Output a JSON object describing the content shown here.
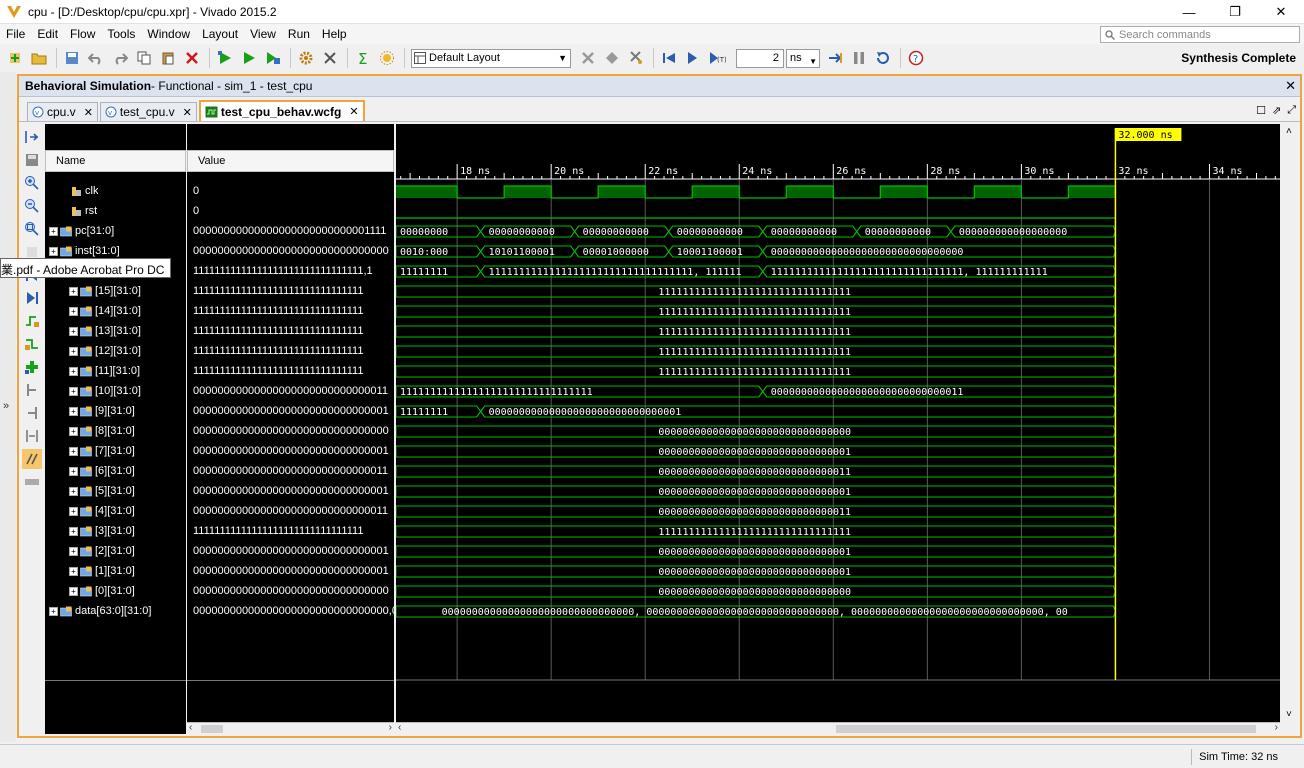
{
  "window": {
    "title": "cpu - [D:/Desktop/cpu/cpu.xpr] - Vivado 2015.2",
    "minimize": "—",
    "maximize": "❐",
    "close": "✕"
  },
  "menu": [
    "File",
    "Edit",
    "Flow",
    "Tools",
    "Window",
    "Layout",
    "View",
    "Run",
    "Help"
  ],
  "command_search": {
    "placeholder": "Search commands"
  },
  "toolbar": {
    "layout": "Default Layout",
    "run_time_value": "2",
    "run_time_unit": "ns",
    "status": "Synthesis Complete"
  },
  "panel": {
    "title_bold": "Behavioral Simulation",
    "title_rest": " - Functional - sim_1 - test_cpu",
    "close": "✕"
  },
  "tabs": [
    {
      "label": "cpu.v",
      "active": false
    },
    {
      "label": "test_cpu.v",
      "active": false
    },
    {
      "label": "test_cpu_behav.wcfg",
      "active": true
    }
  ],
  "columns": {
    "name": "Name",
    "value": "Value"
  },
  "tooltip": "業.pdf - Adobe Acrobat Pro DC",
  "signals": [
    {
      "name": "clk",
      "value": "0",
      "indent": 1,
      "type": "bit",
      "expand": false
    },
    {
      "name": "rst",
      "value": "0",
      "indent": 1,
      "type": "bit",
      "expand": false
    },
    {
      "name": "pc[31:0]",
      "value": "00000000000000000000000000001111",
      "indent": 0,
      "type": "bus",
      "expand": true
    },
    {
      "name": "inst[31:0]",
      "value": "00000000000000000000000000000000",
      "indent": 0,
      "type": "bus",
      "expand": true
    },
    {
      "name": "",
      "value": "11111111111111111111111111111111,1",
      "indent": 0,
      "type": "bus",
      "expand": true
    },
    {
      "name": "[15][31:0]",
      "value": "11111111111111111111111111111111",
      "indent": 2,
      "type": "bus",
      "expand": true
    },
    {
      "name": "[14][31:0]",
      "value": "11111111111111111111111111111111",
      "indent": 2,
      "type": "bus",
      "expand": true
    },
    {
      "name": "[13][31:0]",
      "value": "11111111111111111111111111111111",
      "indent": 2,
      "type": "bus",
      "expand": true
    },
    {
      "name": "[12][31:0]",
      "value": "11111111111111111111111111111111",
      "indent": 2,
      "type": "bus",
      "expand": true
    },
    {
      "name": "[11][31:0]",
      "value": "11111111111111111111111111111111",
      "indent": 2,
      "type": "bus",
      "expand": true
    },
    {
      "name": "[10][31:0]",
      "value": "00000000000000000000000000000011",
      "indent": 2,
      "type": "bus",
      "expand": true
    },
    {
      "name": "[9][31:0]",
      "value": "00000000000000000000000000000001",
      "indent": 2,
      "type": "bus",
      "expand": true
    },
    {
      "name": "[8][31:0]",
      "value": "00000000000000000000000000000000",
      "indent": 2,
      "type": "bus",
      "expand": true
    },
    {
      "name": "[7][31:0]",
      "value": "00000000000000000000000000000001",
      "indent": 2,
      "type": "bus",
      "expand": true
    },
    {
      "name": "[6][31:0]",
      "value": "00000000000000000000000000000011",
      "indent": 2,
      "type": "bus",
      "expand": true
    },
    {
      "name": "[5][31:0]",
      "value": "00000000000000000000000000000001",
      "indent": 2,
      "type": "bus",
      "expand": true
    },
    {
      "name": "[4][31:0]",
      "value": "00000000000000000000000000000011",
      "indent": 2,
      "type": "bus",
      "expand": true
    },
    {
      "name": "[3][31:0]",
      "value": "11111111111111111111111111111111",
      "indent": 2,
      "type": "bus",
      "expand": true
    },
    {
      "name": "[2][31:0]",
      "value": "00000000000000000000000000000001",
      "indent": 2,
      "type": "bus",
      "expand": true
    },
    {
      "name": "[1][31:0]",
      "value": "00000000000000000000000000000001",
      "indent": 2,
      "type": "bus",
      "expand": true
    },
    {
      "name": "[0][31:0]",
      "value": "00000000000000000000000000000000",
      "indent": 2,
      "type": "bus",
      "expand": true
    },
    {
      "name": "data[63:0][31:0]",
      "value": "00000000000000000000000000000000,0",
      "indent": 0,
      "type": "bus",
      "expand": true
    }
  ],
  "waveform": {
    "time_start_ns": 16.7,
    "time_end_ns": 35.5,
    "ticks": [
      {
        "t": 18,
        "label": "18 ns"
      },
      {
        "t": 20,
        "label": "20 ns"
      },
      {
        "t": 22,
        "label": "22 ns"
      },
      {
        "t": 24,
        "label": "24 ns"
      },
      {
        "t": 26,
        "label": "26 ns"
      },
      {
        "t": 28,
        "label": "28 ns"
      },
      {
        "t": 30,
        "label": "30 ns"
      },
      {
        "t": 32,
        "label": "32 ns"
      },
      {
        "t": 34,
        "label": "34 ns"
      }
    ],
    "cursor_ns": 32,
    "cursor_label": "32.000 ns",
    "sim_end_ns": 32,
    "clock": {
      "first_high_ns": 16.7,
      "first_low_ns": 18,
      "period_ns": 2,
      "high_ns": 1
    },
    "buses": [
      {
        "row": 2,
        "segments": [
          {
            "start": 16.7,
            "label": "00000000"
          },
          {
            "start": 18.5,
            "label": "00000000000"
          },
          {
            "start": 20.5,
            "label": "00000000000"
          },
          {
            "start": 22.5,
            "label": "00000000000"
          },
          {
            "start": 24.5,
            "label": "00000000000"
          },
          {
            "start": 26.5,
            "label": "00000000000"
          },
          {
            "start": 28.5,
            "label": "000000000000000000"
          }
        ]
      },
      {
        "row": 3,
        "segments": [
          {
            "start": 16.7,
            "label": "0010:000"
          },
          {
            "start": 18.5,
            "label": "10101100001"
          },
          {
            "start": 20.5,
            "label": "00001000000"
          },
          {
            "start": 22.5,
            "label": "10001100001"
          },
          {
            "start": 24.5,
            "label": "00000000000000000000000000000000"
          }
        ]
      },
      {
        "row": 4,
        "segments": [
          {
            "start": 16.7,
            "label": "11111111"
          },
          {
            "start": 18.5,
            "label": "1111111111111111111111111111111111, 111111"
          },
          {
            "start": 24.5,
            "label": "11111111111111111111111111111111, 111111111111"
          }
        ]
      },
      {
        "row": 5,
        "segments": [
          {
            "start": 16.7,
            "label": "11111111111111111111111111111111"
          }
        ]
      },
      {
        "row": 6,
        "segments": [
          {
            "start": 16.7,
            "label": "11111111111111111111111111111111"
          }
        ]
      },
      {
        "row": 7,
        "segments": [
          {
            "start": 16.7,
            "label": "11111111111111111111111111111111"
          }
        ]
      },
      {
        "row": 8,
        "segments": [
          {
            "start": 16.7,
            "label": "11111111111111111111111111111111"
          }
        ]
      },
      {
        "row": 9,
        "segments": [
          {
            "start": 16.7,
            "label": "11111111111111111111111111111111"
          }
        ]
      },
      {
        "row": 10,
        "segments": [
          {
            "start": 16.7,
            "label": "11111111111111111111111111111111"
          },
          {
            "start": 24.5,
            "label": "00000000000000000000000000000011"
          }
        ]
      },
      {
        "row": 11,
        "segments": [
          {
            "start": 16.7,
            "label": "11111111"
          },
          {
            "start": 18.5,
            "label": "00000000000000000000000000000001"
          }
        ]
      },
      {
        "row": 12,
        "segments": [
          {
            "start": 16.7,
            "label": "00000000000000000000000000000000"
          }
        ]
      },
      {
        "row": 13,
        "segments": [
          {
            "start": 16.7,
            "label": "00000000000000000000000000000001"
          }
        ]
      },
      {
        "row": 14,
        "segments": [
          {
            "start": 16.7,
            "label": "00000000000000000000000000000011"
          }
        ]
      },
      {
        "row": 15,
        "segments": [
          {
            "start": 16.7,
            "label": "00000000000000000000000000000001"
          }
        ]
      },
      {
        "row": 16,
        "segments": [
          {
            "start": 16.7,
            "label": "00000000000000000000000000000011"
          }
        ]
      },
      {
        "row": 17,
        "segments": [
          {
            "start": 16.7,
            "label": "11111111111111111111111111111111"
          }
        ]
      },
      {
        "row": 18,
        "segments": [
          {
            "start": 16.7,
            "label": "00000000000000000000000000000001"
          }
        ]
      },
      {
        "row": 19,
        "segments": [
          {
            "start": 16.7,
            "label": "00000000000000000000000000000001"
          }
        ]
      },
      {
        "row": 20,
        "segments": [
          {
            "start": 16.7,
            "label": "00000000000000000000000000000000"
          }
        ]
      },
      {
        "row": 21,
        "segments": [
          {
            "start": 16.7,
            "label": "00000000000000000000000000000000, 00000000000000000000000000000000, 00000000000000000000000000000000, 00"
          }
        ]
      }
    ]
  },
  "status": {
    "sim_time": "Sim Time: 32 ns"
  },
  "colors": {
    "wave_green": "#00c000",
    "cursor_yellow": "#ffff00",
    "panel_border": "#f1a33d"
  },
  "icons": {
    "toolbar": [
      "add-sources-icon",
      "open-project-icon",
      "open-icon",
      "undo-icon",
      "redo-icon",
      "copy-icon",
      "paste-icon",
      "delete-icon",
      "run-all-icon",
      "run-icon",
      "run-to-icon",
      "settings-icon",
      "tools-icon",
      "report-sigma-icon",
      "sun-icon"
    ]
  }
}
